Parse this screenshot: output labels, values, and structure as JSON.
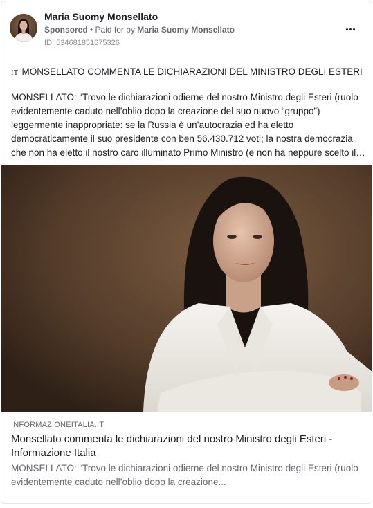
{
  "ad": {
    "author_name": "Maria Suomy Monsellato",
    "sponsored_label": "Sponsored",
    "separator": " • ",
    "paid_for_prefix": "Paid for by ",
    "paid_for_name": "Maria Suomy Monsellato",
    "id_line": "ID: 534681851675326",
    "more_icon": "more-horizontal-icon"
  },
  "post": {
    "language_tag": "IT",
    "headline": "MONSELLATO COMMENTA LE DICHIARAZIONI DEL MINISTRO DEGLI ESTERI",
    "body": "MONSELLATO: “Trovo le dichiarazioni odierne del nostro Ministro degli Esteri (ruolo evidentemente caduto nell’oblio dopo la creazione del suo nuovo “gruppo”) leggermente inappropriate: se la Russia è un’autocrazia ed ha eletto democraticamente il suo presidente con ben 56.430.712 voti; la nostra democrazia che non ha eletto il nostro caro illuminato Primo Ministro (e non ha neppure scelto il suo governo)..."
  },
  "link_preview": {
    "domain": "INFORMAZIONEITALIA.IT",
    "title": "Monsellato commenta le dichiarazioni del nostro Ministro degli Esteri - Informazione Italia",
    "description": "MONSELLATO: “Trovo le dichiarazioni odierne del nostro Ministro degli Esteri (ruolo evidentemente caduto nell’oblio dopo la creazione..."
  },
  "colors": {
    "text_primary": "#1c1e21",
    "text_secondary": "#65676b",
    "photo_background": "#5a4331"
  }
}
